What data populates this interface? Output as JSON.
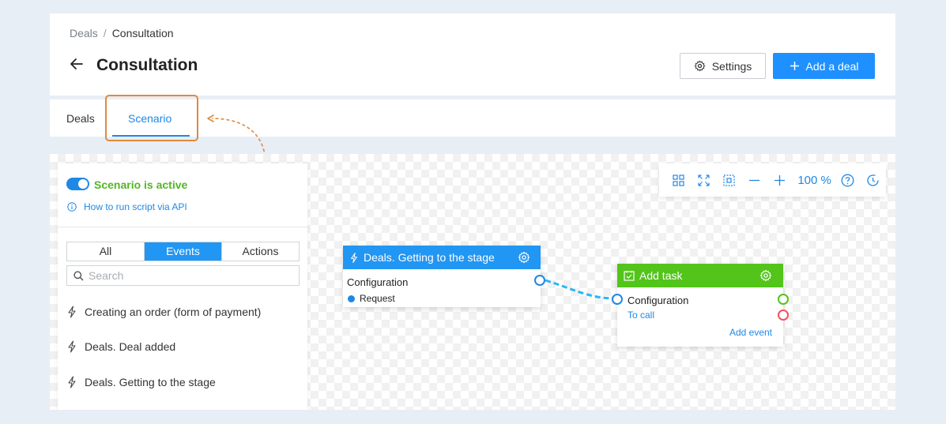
{
  "breadcrumb": {
    "parent": "Deals",
    "separator": "/",
    "current": "Consultation"
  },
  "header": {
    "title": "Consultation",
    "settings_label": "Settings",
    "add_label": "Add a deal"
  },
  "tabs": [
    {
      "label": "Deals",
      "active": false
    },
    {
      "label": "Scenario",
      "active": true
    }
  ],
  "panel": {
    "status": "Scenario is active",
    "active": true,
    "api_link": "How to run script via API",
    "filters": [
      {
        "label": "All",
        "active": false
      },
      {
        "label": "Events",
        "active": true
      },
      {
        "label": "Actions",
        "active": false
      }
    ],
    "search_placeholder": "Search",
    "events": [
      "Creating an order (form of payment)",
      "Deals. Deal added",
      "Deals. Getting to the stage"
    ]
  },
  "toolbar": {
    "zoom_label": "100 %",
    "icons": [
      "grid-icon",
      "fit-screen-icon",
      "frame-icon",
      "zoom-out-icon",
      "zoom-in-icon",
      "help-icon",
      "history-icon"
    ]
  },
  "nodes": {
    "trigger": {
      "title": "Deals. Getting to the stage",
      "config_label": "Configuration",
      "output_label": "Request",
      "color": "#2196f3"
    },
    "task": {
      "title": "Add task",
      "config_label": "Configuration",
      "link_label": "To call",
      "add_event_label": "Add event",
      "color": "#52c41a"
    }
  },
  "colors": {
    "primary": "#1e90ff",
    "success": "#52c41a",
    "danger": "#f5515f",
    "highlight": "#e08a3c"
  }
}
